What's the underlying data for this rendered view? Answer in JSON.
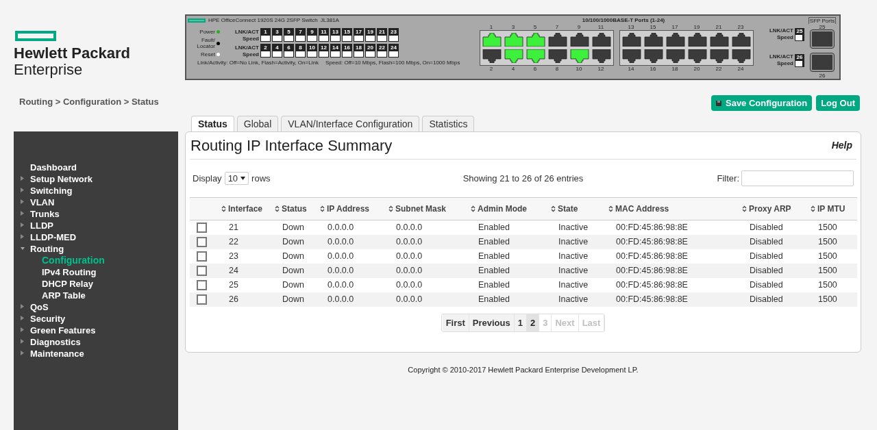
{
  "logo": {
    "line1": "Hewlett Packard",
    "line2": "Enterprise"
  },
  "device": {
    "model": "HPE OfficeConnect 1920S 24G 2SFP Switch",
    "model_code": "JL381A",
    "leds": [
      {
        "label": "Power",
        "color": "#22b322"
      },
      {
        "label": "Fault/ Locator",
        "color": "#000000"
      },
      {
        "label": "Reset",
        "color": "#ffffff"
      }
    ],
    "indicator_rows": [
      {
        "label": "LNK/ACT",
        "speed_label": "Speed",
        "ports": [
          "1",
          "3",
          "5",
          "7",
          "9",
          "11",
          "13",
          "15",
          "17",
          "19",
          "21",
          "23"
        ]
      },
      {
        "label": "LNK/ACT",
        "speed_label": "Speed",
        "ports": [
          "2",
          "4",
          "6",
          "8",
          "10",
          "12",
          "14",
          "16",
          "18",
          "20",
          "22",
          "24"
        ]
      }
    ],
    "legend": [
      "Link/Activity: Off=No Link, Flash=Activity, On=Link",
      "Speed: Off=10 Mbps, Flash=100 Mbps, On=1000 Mbps"
    ],
    "ports_title": "10/100/1000BASE-T Ports (1-24)",
    "port_groups": [
      {
        "top": [
          {
            "number": "1",
            "link": true
          },
          {
            "number": "3",
            "link": true
          },
          {
            "number": "5",
            "link": true
          },
          {
            "number": "7",
            "link": false
          },
          {
            "number": "9",
            "link": false
          },
          {
            "number": "11",
            "link": false
          }
        ],
        "bottom": [
          {
            "number": "2",
            "link": false
          },
          {
            "number": "4",
            "link": true
          },
          {
            "number": "6",
            "link": true
          },
          {
            "number": "8",
            "link": false
          },
          {
            "number": "10",
            "link": true
          },
          {
            "number": "12",
            "link": false
          }
        ]
      },
      {
        "top": [
          {
            "number": "13",
            "link": false
          },
          {
            "number": "15",
            "link": false
          },
          {
            "number": "17",
            "link": false
          },
          {
            "number": "19",
            "link": false
          },
          {
            "number": "21",
            "link": false
          },
          {
            "number": "23",
            "link": false
          }
        ],
        "bottom": [
          {
            "number": "14",
            "link": false
          },
          {
            "number": "16",
            "link": false
          },
          {
            "number": "18",
            "link": false
          },
          {
            "number": "20",
            "link": false
          },
          {
            "number": "22",
            "link": false
          },
          {
            "number": "24",
            "link": false
          }
        ]
      }
    ],
    "sfp": {
      "title": "SFP Ports",
      "ports": [
        {
          "indicator_label": "LNK/ACT",
          "number": "25",
          "speed_label": "Speed",
          "cage_number": "25"
        },
        {
          "indicator_label": "LNK/ACT",
          "number": "26",
          "speed_label": "Speed",
          "cage_number": "26"
        }
      ]
    }
  },
  "breadcrumb": "Routing > Configuration > Status",
  "header_buttons": [
    {
      "label": "Save Configuration",
      "kind": "save"
    },
    {
      "label": "Log Out",
      "kind": "plain"
    }
  ],
  "sidebar": {
    "items": [
      {
        "label": "Dashboard",
        "kind": "link"
      },
      {
        "label": "Setup Network",
        "kind": "folder",
        "expanded": false
      },
      {
        "label": "Switching",
        "kind": "folder",
        "expanded": false
      },
      {
        "label": "VLAN",
        "kind": "folder",
        "expanded": false
      },
      {
        "label": "Trunks",
        "kind": "folder",
        "expanded": false
      },
      {
        "label": "LLDP",
        "kind": "folder",
        "expanded": false
      },
      {
        "label": "LLDP-MED",
        "kind": "folder",
        "expanded": false
      },
      {
        "label": "Routing",
        "kind": "folder",
        "expanded": true,
        "children": [
          {
            "label": "Configuration",
            "selected": true
          },
          {
            "label": "IPv4 Routing",
            "selected": false
          },
          {
            "label": "DHCP Relay",
            "selected": false
          },
          {
            "label": "ARP Table",
            "selected": false
          }
        ]
      },
      {
        "label": "QoS",
        "kind": "folder",
        "expanded": false
      },
      {
        "label": "Security",
        "kind": "folder",
        "expanded": false
      },
      {
        "label": "Green Features",
        "kind": "folder",
        "expanded": false
      },
      {
        "label": "Diagnostics",
        "kind": "folder",
        "expanded": false
      },
      {
        "label": "Maintenance",
        "kind": "folder",
        "expanded": false
      }
    ]
  },
  "tabs": [
    {
      "label": "Status",
      "selected": true
    },
    {
      "label": "Global",
      "selected": false
    },
    {
      "label": "VLAN/Interface Configuration",
      "selected": false
    },
    {
      "label": "Statistics",
      "selected": false
    }
  ],
  "title": "Routing IP Interface Summary",
  "help": "Help",
  "display": {
    "label": "Display",
    "value": "10",
    "suffix": "rows"
  },
  "showing": "Showing 21 to 26 of 26 entries",
  "filter": {
    "label": "Filter:"
  },
  "table": {
    "columns": [
      "Interface",
      "Status",
      "IP Address",
      "Subnet Mask",
      "Admin Mode",
      "State",
      "MAC Address",
      "Proxy ARP",
      "IP MTU"
    ],
    "rows": [
      {
        "checked": false,
        "cells": [
          "21",
          "Down",
          "0.0.0.0",
          "0.0.0.0",
          "Enabled",
          "Inactive",
          "00:FD:45:86:98:8E",
          "Disabled",
          "1500"
        ]
      },
      {
        "checked": false,
        "cells": [
          "22",
          "Down",
          "0.0.0.0",
          "0.0.0.0",
          "Enabled",
          "Inactive",
          "00:FD:45:86:98:8E",
          "Disabled",
          "1500"
        ]
      },
      {
        "checked": false,
        "cells": [
          "23",
          "Down",
          "0.0.0.0",
          "0.0.0.0",
          "Enabled",
          "Inactive",
          "00:FD:45:86:98:8E",
          "Disabled",
          "1500"
        ]
      },
      {
        "checked": false,
        "cells": [
          "24",
          "Down",
          "0.0.0.0",
          "0.0.0.0",
          "Enabled",
          "Inactive",
          "00:FD:45:86:98:8E",
          "Disabled",
          "1500"
        ]
      },
      {
        "checked": false,
        "cells": [
          "25",
          "Down",
          "0.0.0.0",
          "0.0.0.0",
          "Enabled",
          "Inactive",
          "00:FD:45:86:98:8E",
          "Disabled",
          "1500"
        ]
      },
      {
        "checked": false,
        "cells": [
          "26",
          "Down",
          "0.0.0.0",
          "0.0.0.0",
          "Enabled",
          "Inactive",
          "00:FD:45:86:98:8E",
          "Disabled",
          "1500"
        ]
      }
    ]
  },
  "pagination": [
    {
      "label": "First",
      "selected": false,
      "disabled": false
    },
    {
      "label": "Previous",
      "selected": false,
      "disabled": false
    },
    {
      "label": "1",
      "selected": false,
      "disabled": false
    },
    {
      "label": "2",
      "selected": true,
      "disabled": false
    },
    {
      "label": "3",
      "selected": false,
      "disabled": true
    },
    {
      "label": "Next",
      "selected": false,
      "disabled": true
    },
    {
      "label": "Last",
      "selected": false,
      "disabled": true
    }
  ],
  "copyright": "Copyright © 2010-2017 Hewlett Packard Enterprise Development LP."
}
